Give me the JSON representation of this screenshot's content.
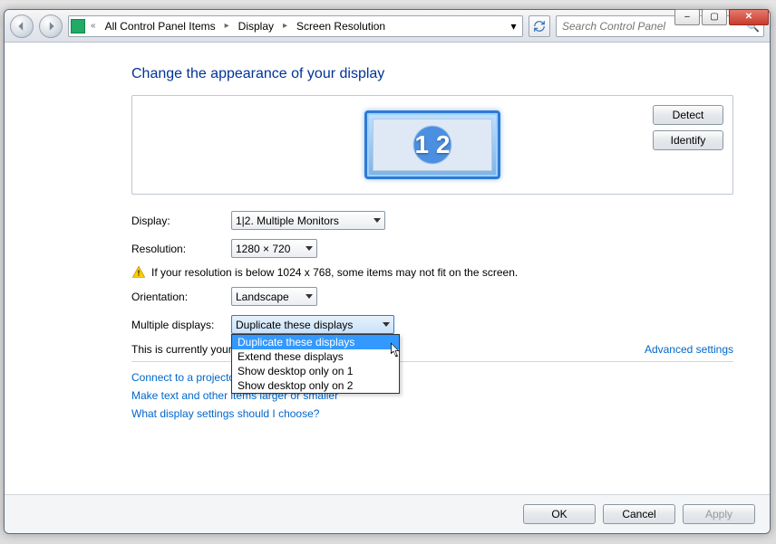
{
  "window_controls": {
    "min": "–",
    "max": "▢",
    "close": "✕"
  },
  "breadcrumbs": {
    "overflow": "«",
    "items": [
      "All Control Panel Items",
      "Display",
      "Screen Resolution"
    ]
  },
  "search": {
    "placeholder": "Search Control Panel"
  },
  "heading": "Change the appearance of your display",
  "monitor_thumb_label": "1 2",
  "buttons": {
    "detect": "Detect",
    "identify": "Identify",
    "ok": "OK",
    "cancel": "Cancel",
    "apply": "Apply"
  },
  "labels": {
    "display": "Display:",
    "resolution": "Resolution:",
    "orientation": "Orientation:",
    "multiple": "Multiple displays:"
  },
  "values": {
    "display": "1|2. Multiple Monitors",
    "resolution": "1280 × 720",
    "orientation": "Landscape",
    "multiple": "Duplicate these displays"
  },
  "multiple_options": [
    "Duplicate these displays",
    "Extend these displays",
    "Show desktop only on 1",
    "Show desktop only on 2"
  ],
  "warning": "If your resolution is below 1024 x 768, some items may not fit on the screen.",
  "main_display_text": "This is currently your main display.",
  "advanced_link": "Advanced settings",
  "projector_link": "Connect to a projector (or press the ⊞ key and tap P)",
  "larger_link": "Make text and other items larger or smaller",
  "which_link": "What display settings should I choose?"
}
